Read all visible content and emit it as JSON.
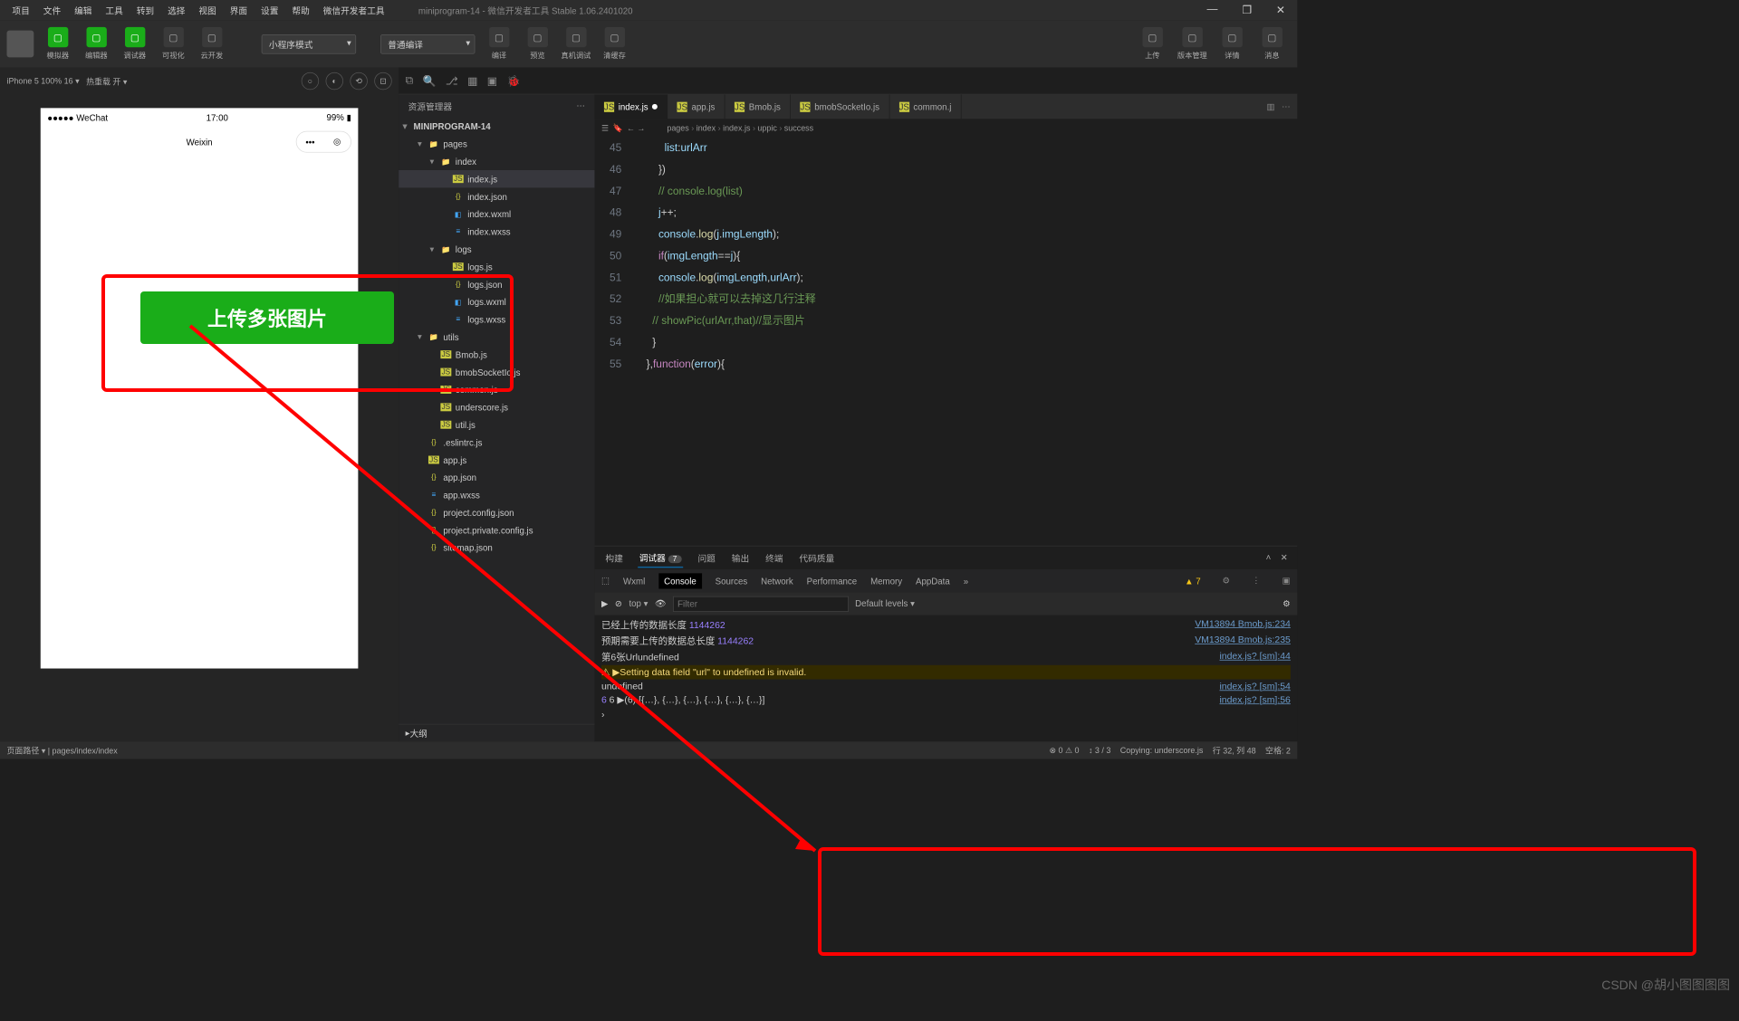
{
  "menu": {
    "items": [
      "项目",
      "文件",
      "编辑",
      "工具",
      "转到",
      "选择",
      "视图",
      "界面",
      "设置",
      "帮助",
      "微信开发者工具"
    ],
    "title": "miniprogram-14 - 微信开发者工具 Stable 1.06.2401020"
  },
  "toolbar": {
    "left": [
      {
        "label": "模拟器",
        "green": true
      },
      {
        "label": "编辑器",
        "green": true
      },
      {
        "label": "调试器",
        "green": true
      },
      {
        "label": "可视化",
        "green": false
      },
      {
        "label": "云开发",
        "green": false
      }
    ],
    "mode": "小程序模式",
    "compile": "普通编译",
    "mid": [
      {
        "label": "编译"
      },
      {
        "label": "预览"
      },
      {
        "label": "真机调试"
      },
      {
        "label": "清缓存"
      }
    ],
    "right": [
      {
        "label": "上传"
      },
      {
        "label": "版本管理"
      },
      {
        "label": "详情"
      },
      {
        "label": "消息"
      }
    ]
  },
  "sim": {
    "device": "iPhone 5 100% 16 ▾",
    "hot": "热重载 开 ▾",
    "signal": "●●●●● WeChat",
    "time": "17:00",
    "battery": "99%",
    "app": "Weixin",
    "uploadBtn": "上传多张图片"
  },
  "explorer": {
    "title": "资源管理器",
    "root": "MINIPROGRAM-14",
    "tree": [
      {
        "d": 1,
        "c": "▾",
        "i": "fold",
        "n": "pages"
      },
      {
        "d": 2,
        "c": "▾",
        "i": "fold",
        "n": "index"
      },
      {
        "d": 3,
        "c": "",
        "i": "js",
        "n": "index.js",
        "sel": true
      },
      {
        "d": 3,
        "c": "",
        "i": "json",
        "n": "index.json"
      },
      {
        "d": 3,
        "c": "",
        "i": "wxml",
        "n": "index.wxml"
      },
      {
        "d": 3,
        "c": "",
        "i": "wxss",
        "n": "index.wxss"
      },
      {
        "d": 2,
        "c": "▾",
        "i": "fold",
        "n": "logs"
      },
      {
        "d": 3,
        "c": "",
        "i": "js",
        "n": "logs.js"
      },
      {
        "d": 3,
        "c": "",
        "i": "json",
        "n": "logs.json"
      },
      {
        "d": 3,
        "c": "",
        "i": "wxml",
        "n": "logs.wxml"
      },
      {
        "d": 3,
        "c": "",
        "i": "wxss",
        "n": "logs.wxss"
      },
      {
        "d": 1,
        "c": "▾",
        "i": "fold",
        "n": "utils"
      },
      {
        "d": 2,
        "c": "",
        "i": "js",
        "n": "Bmob.js"
      },
      {
        "d": 2,
        "c": "",
        "i": "js",
        "n": "bmobSocketIo.js"
      },
      {
        "d": 2,
        "c": "",
        "i": "js",
        "n": "common.js"
      },
      {
        "d": 2,
        "c": "",
        "i": "js",
        "n": "underscore.js"
      },
      {
        "d": 2,
        "c": "",
        "i": "js",
        "n": "util.js"
      },
      {
        "d": 1,
        "c": "",
        "i": "json",
        "n": ".eslintrc.js"
      },
      {
        "d": 1,
        "c": "",
        "i": "js",
        "n": "app.js"
      },
      {
        "d": 1,
        "c": "",
        "i": "json",
        "n": "app.json"
      },
      {
        "d": 1,
        "c": "",
        "i": "wxss",
        "n": "app.wxss"
      },
      {
        "d": 1,
        "c": "",
        "i": "json",
        "n": "project.config.json"
      },
      {
        "d": 1,
        "c": "",
        "i": "json",
        "n": "project.private.config.js"
      },
      {
        "d": 1,
        "c": "",
        "i": "json",
        "n": "sitemap.json"
      }
    ],
    "outline": "大纲"
  },
  "tabs": [
    {
      "n": "index.js",
      "active": true,
      "dirty": true
    },
    {
      "n": "app.js"
    },
    {
      "n": "Bmob.js"
    },
    {
      "n": "bmobSocketIo.js"
    },
    {
      "n": "common.j"
    }
  ],
  "crumbs": [
    "pages",
    "index",
    "index.js",
    "uppic",
    "success"
  ],
  "code": {
    "start": 45,
    "lines": [
      "            <span class='tk-v'>list</span>:<span class='tk-v'>urlArr</span>",
      "          })",
      "          <span class='tk-c'>// console.log(list)</span>",
      "          <span class='tk-v'>j</span>++;",
      "          <span class='tk-v'>console</span>.<span class='tk-f'>log</span>(<span class='tk-v'>j</span>.<span class='tk-v'>imgLength</span>);",
      "          <span class='tk-k'>if</span>(<span class='tk-v'>imgLength</span>==<span class='tk-v'>j</span>){",
      "          <span class='tk-v'>console</span>.<span class='tk-f'>log</span>(<span class='tk-v'>imgLength</span>,<span class='tk-v'>urlArr</span>);",
      "          <span class='tk-c'>//如果担心就可以去掉这几行注释</span>",
      "        <span class='tk-c'>// showPic(urlArr,that)//显示图片</span>",
      "        }",
      "      },<span class='tk-k'>function</span>(<span class='tk-v'>error</span>){"
    ]
  },
  "bottom": {
    "tabs": [
      "构建",
      "调试器",
      "问题",
      "输出",
      "终端",
      "代码质量"
    ],
    "badge": "7",
    "devtabs": [
      "Wxml",
      "Console",
      "Sources",
      "Network",
      "Performance",
      "Memory",
      "AppData"
    ],
    "warnCount": "7",
    "filter": {
      "ctx": "top",
      "placeholder": "Filter",
      "levels": "Default levels ▾"
    },
    "lines": [
      {
        "t": "已经上传的数据长度 ",
        "v": "1144262",
        "s": "VM13894 Bmob.js:234"
      },
      {
        "t": "预期需要上传的数据总长度 ",
        "v": "1144262",
        "s": "VM13894 Bmob.js:235"
      },
      {
        "t": "第6张Urlundefined",
        "s": "index.js? [sm]:44"
      },
      {
        "t": "▶Setting data field \"url\" to undefined is invalid.",
        "warn": true
      },
      {
        "t": "undefined",
        "s": "index.js? [sm]:54"
      },
      {
        "t": "6  ▶(6) [{…}, {…}, {…}, {…}, {…}, {…}]",
        "num": true,
        "s": "index.js? [sm]:56"
      },
      {
        "t": "›",
        "prompt": true
      }
    ]
  },
  "status": {
    "path": "页面路径 ▾ | pages/index/index",
    "err": "⊗ 0 ⚠ 0",
    "diff": "↕ 3 / 3",
    "copy": "Copying: underscore.js",
    "pos": "行 32, 列 48",
    "enc": "空格: 2",
    "watermark": "CSDN @胡小图图图图"
  }
}
